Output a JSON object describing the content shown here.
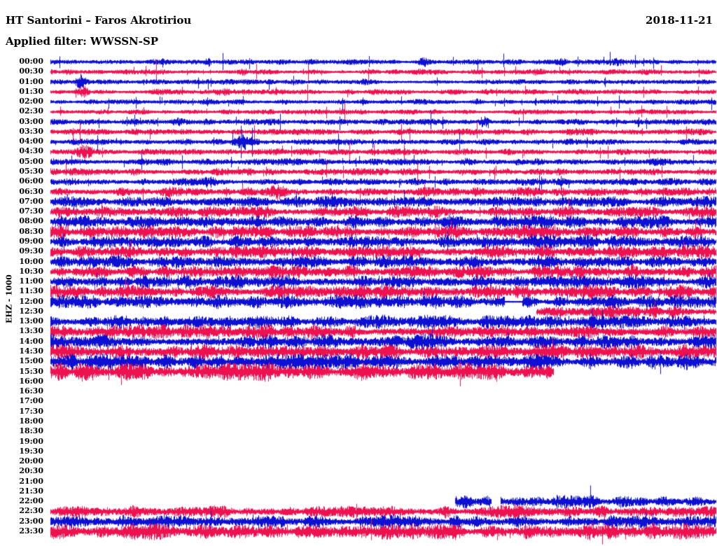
{
  "header": {
    "station_title": "HT Santorini – Faros Akrotiriou",
    "filter_label": "Applied filter: WWSSN-SP",
    "date": "2018-11-21"
  },
  "chart_data": {
    "type": "helicorder",
    "title": "HT Santorini – Faros Akrotiriou",
    "subtitle": "Applied filter: WWSSN-SP",
    "date": "2018-11-21",
    "y_axis_label": "EHZ - 1000",
    "row_interval_minutes": 30,
    "time_axis_start": "00:00",
    "time_axis_end": "23:30",
    "legend_position": "none",
    "grid": false,
    "trace_colors": {
      "blue": "#0d10d2",
      "red": "#ee1150"
    },
    "rows": [
      {
        "time": "00:00",
        "color": "blue",
        "amp": 2.8,
        "segments": [
          [
            0,
            1
          ]
        ],
        "events": [
          {
            "pos": 0.237,
            "mult": 3.5,
            "w": 0.004
          },
          {
            "pos": 0.56,
            "mult": 2.0,
            "w": 0.01
          },
          {
            "pos": 0.77,
            "mult": 2.4,
            "w": 0.008
          },
          {
            "pos": 0.855,
            "mult": 2.2,
            "w": 0.008
          }
        ]
      },
      {
        "time": "00:30",
        "color": "red",
        "amp": 2.8,
        "segments": [
          [
            0,
            1
          ]
        ],
        "events": [
          {
            "pos": 0.023,
            "mult": 2.2,
            "w": 0.008
          },
          {
            "pos": 0.29,
            "mult": 2.0,
            "w": 0.006
          },
          {
            "pos": 0.56,
            "mult": 2.2,
            "w": 0.008
          },
          {
            "pos": 0.73,
            "mult": 2.0,
            "w": 0.012
          }
        ]
      },
      {
        "time": "01:00",
        "color": "blue",
        "amp": 2.8,
        "segments": [
          [
            0,
            1
          ]
        ],
        "events": [
          {
            "pos": 0.045,
            "mult": 4.0,
            "w": 0.007
          },
          {
            "pos": 0.31,
            "mult": 2.0,
            "w": 0.006
          },
          {
            "pos": 0.47,
            "mult": 2.0,
            "w": 0.006
          }
        ]
      },
      {
        "time": "01:30",
        "color": "red",
        "amp": 2.9,
        "segments": [
          [
            0,
            1
          ]
        ],
        "events": [
          {
            "pos": 0.05,
            "mult": 2.6,
            "w": 0.008
          },
          {
            "pos": 0.26,
            "mult": 2.0,
            "w": 0.01
          }
        ]
      },
      {
        "time": "02:00",
        "color": "blue",
        "amp": 2.8,
        "segments": [
          [
            0,
            1
          ]
        ],
        "events": [
          {
            "pos": 0.35,
            "mult": 2.0,
            "w": 0.008
          },
          {
            "pos": 0.64,
            "mult": 1.8,
            "w": 0.008
          }
        ]
      },
      {
        "time": "02:30",
        "color": "red",
        "amp": 2.7,
        "segments": [
          [
            0,
            1
          ]
        ],
        "events": [
          {
            "pos": 0.33,
            "mult": 2.0,
            "w": 0.008
          }
        ]
      },
      {
        "time": "03:00",
        "color": "blue",
        "amp": 3.2,
        "segments": [
          [
            0,
            1
          ]
        ],
        "events": [
          {
            "pos": 0.19,
            "mult": 2.6,
            "w": 0.008
          },
          {
            "pos": 0.65,
            "mult": 2.6,
            "w": 0.006
          }
        ]
      },
      {
        "time": "03:30",
        "color": "red",
        "amp": 3.4,
        "segments": [
          [
            0,
            1
          ]
        ],
        "events": [
          {
            "pos": 0.06,
            "mult": 2.0,
            "w": 0.01
          },
          {
            "pos": 0.35,
            "mult": 2.4,
            "w": 0.014
          }
        ]
      },
      {
        "time": "04:00",
        "color": "blue",
        "amp": 3.4,
        "segments": [
          [
            0,
            1
          ]
        ],
        "events": [
          {
            "pos": 0.29,
            "mult": 2.8,
            "w": 0.012
          }
        ]
      },
      {
        "time": "04:30",
        "color": "red",
        "amp": 3.6,
        "segments": [
          [
            0,
            1
          ]
        ],
        "events": [
          {
            "pos": 0.05,
            "mult": 2.8,
            "w": 0.012
          }
        ]
      },
      {
        "time": "05:00",
        "color": "blue",
        "amp": 3.8,
        "segments": [
          [
            0,
            1
          ]
        ],
        "events": []
      },
      {
        "time": "05:30",
        "color": "red",
        "amp": 3.8,
        "segments": [
          [
            0,
            1
          ]
        ],
        "events": [
          {
            "pos": 0.3,
            "mult": 1.8,
            "w": 0.01
          }
        ]
      },
      {
        "time": "06:00",
        "color": "blue",
        "amp": 4.0,
        "segments": [
          [
            0,
            1
          ]
        ],
        "events": [
          {
            "pos": 0.24,
            "mult": 2.0,
            "w": 0.008
          }
        ]
      },
      {
        "time": "06:30",
        "color": "red",
        "amp": 5.0,
        "segments": [
          [
            0,
            1
          ]
        ],
        "events": [
          {
            "pos": 0.34,
            "mult": 1.9,
            "w": 0.01
          }
        ]
      },
      {
        "time": "07:00",
        "color": "blue",
        "amp": 6.0,
        "segments": [
          [
            0,
            1
          ]
        ],
        "events": []
      },
      {
        "time": "07:30",
        "color": "red",
        "amp": 6.5,
        "segments": [
          [
            0,
            1
          ]
        ],
        "events": []
      },
      {
        "time": "08:00",
        "color": "blue",
        "amp": 7.0,
        "segments": [
          [
            0,
            1
          ]
        ],
        "events": []
      },
      {
        "time": "08:30",
        "color": "red",
        "amp": 7.2,
        "segments": [
          [
            0,
            1
          ]
        ],
        "events": []
      },
      {
        "time": "09:00",
        "color": "blue",
        "amp": 7.2,
        "segments": [
          [
            0,
            1
          ]
        ],
        "events": []
      },
      {
        "time": "09:30",
        "color": "red",
        "amp": 7.2,
        "segments": [
          [
            0,
            1
          ]
        ],
        "events": []
      },
      {
        "time": "10:00",
        "color": "blue",
        "amp": 7.2,
        "segments": [
          [
            0,
            1
          ]
        ],
        "events": []
      },
      {
        "time": "10:30",
        "color": "red",
        "amp": 7.2,
        "segments": [
          [
            0,
            1
          ]
        ],
        "events": []
      },
      {
        "time": "11:00",
        "color": "blue",
        "amp": 7.2,
        "segments": [
          [
            0,
            1
          ]
        ],
        "events": []
      },
      {
        "time": "11:30",
        "color": "red",
        "amp": 7.2,
        "segments": [
          [
            0,
            1
          ]
        ],
        "events": []
      },
      {
        "time": "12:00",
        "color": "blue",
        "amp": 7.5,
        "segments": [
          [
            0,
            1
          ]
        ],
        "quiet": [
          [
            0.683,
            0.709
          ]
        ],
        "events": []
      },
      {
        "time": "12:30",
        "color": "red",
        "amp": 7.0,
        "segments": [
          [
            0.731,
            1
          ]
        ],
        "events": []
      },
      {
        "time": "13:00",
        "color": "blue",
        "amp": 7.5,
        "segments": [
          [
            0,
            1
          ]
        ],
        "events": []
      },
      {
        "time": "13:30",
        "color": "red",
        "amp": 7.5,
        "segments": [
          [
            0,
            1
          ]
        ],
        "events": []
      },
      {
        "time": "14:00",
        "color": "blue",
        "amp": 8.0,
        "segments": [
          [
            0,
            1
          ]
        ],
        "events": []
      },
      {
        "time": "14:30",
        "color": "red",
        "amp": 8.0,
        "segments": [
          [
            0,
            1
          ]
        ],
        "events": []
      },
      {
        "time": "15:00",
        "color": "blue",
        "amp": 8.5,
        "segments": [
          [
            0,
            1
          ]
        ],
        "events": []
      },
      {
        "time": "15:30",
        "color": "red",
        "amp": 10.0,
        "segments": [
          [
            0,
            0.756
          ]
        ],
        "events": []
      },
      {
        "time": "16:00",
        "color": "blue",
        "amp": 0,
        "segments": [],
        "events": []
      },
      {
        "time": "16:30",
        "color": "red",
        "amp": 0,
        "segments": [],
        "events": []
      },
      {
        "time": "17:00",
        "color": "blue",
        "amp": 0,
        "segments": [],
        "events": []
      },
      {
        "time": "17:30",
        "color": "red",
        "amp": 0,
        "segments": [],
        "events": []
      },
      {
        "time": "18:00",
        "color": "blue",
        "amp": 0,
        "segments": [],
        "events": []
      },
      {
        "time": "18:30",
        "color": "red",
        "amp": 0,
        "segments": [],
        "events": []
      },
      {
        "time": "19:00",
        "color": "blue",
        "amp": 0,
        "segments": [],
        "events": []
      },
      {
        "time": "19:30",
        "color": "red",
        "amp": 0,
        "segments": [],
        "events": []
      },
      {
        "time": "20:00",
        "color": "blue",
        "amp": 0,
        "segments": [],
        "events": []
      },
      {
        "time": "20:30",
        "color": "red",
        "amp": 0,
        "segments": [],
        "events": []
      },
      {
        "time": "21:00",
        "color": "blue",
        "amp": 0,
        "segments": [],
        "events": []
      },
      {
        "time": "21:30",
        "color": "red",
        "amp": 0,
        "segments": [],
        "events": []
      },
      {
        "time": "22:00",
        "color": "blue",
        "amp": 7.0,
        "segments": [
          [
            0.608,
            0.662
          ],
          [
            0.677,
            1
          ]
        ],
        "events": []
      },
      {
        "time": "22:30",
        "color": "red",
        "amp": 7.0,
        "segments": [
          [
            0,
            1
          ]
        ],
        "events": []
      },
      {
        "time": "23:00",
        "color": "blue",
        "amp": 7.0,
        "segments": [
          [
            0,
            1
          ]
        ],
        "events": []
      },
      {
        "time": "23:30",
        "color": "red",
        "amp": 9.0,
        "segments": [
          [
            0,
            1
          ]
        ],
        "events": []
      }
    ]
  }
}
